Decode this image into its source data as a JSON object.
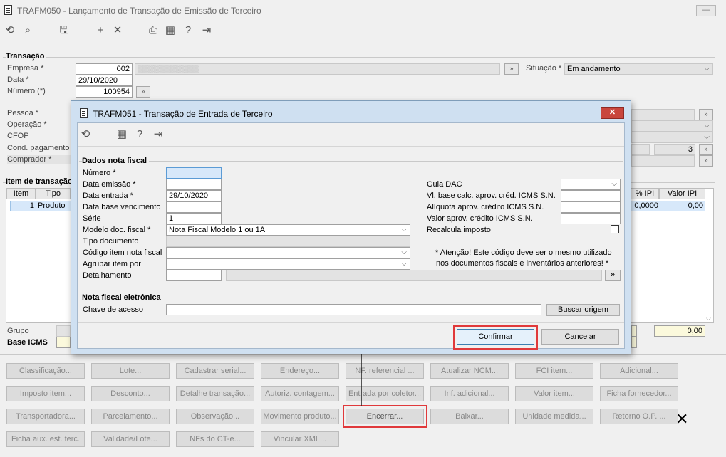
{
  "window": {
    "title": "TRAFM050 - Lançamento de Transação de Emissão de Terceiro"
  },
  "icons": [
    "refresh-icon",
    "search-icon",
    "save-icon",
    "add-icon",
    "delete-icon",
    "print-icon",
    "calendar-icon",
    "help-icon",
    "exit-icon"
  ],
  "transacao": {
    "group_title": "Transação",
    "empresa_label": "Empresa *",
    "empresa_value": "002",
    "empresa_name": "▒▒▒▒▒▒▒▒▒▒▒",
    "data_label": "Data *",
    "data_value": "29/10/2020",
    "numero_label": "Número (*)",
    "numero_value": "100954",
    "situacao_label": "Situação *",
    "situacao_value": "Em andamento",
    "pessoa_label": "Pessoa *",
    "operacao_label": "Operação *",
    "cfop_label": "CFOP",
    "cond_label": "Cond. pagamento *",
    "cond_value": "3",
    "comprador_label": "Comprador *"
  },
  "itens": {
    "group_title": "Item de transação",
    "headers": {
      "item": "Item",
      "tipo": "Tipo",
      "ipi_pct": "% IPI",
      "valor_ipi": "Valor IPI"
    },
    "row": {
      "item": "1",
      "tipo": "Produto",
      "ipi_pct": "0,0000",
      "valor_ipi": "0,00"
    },
    "grupo_label": "Grupo",
    "base_icms_label": "Base ICMS",
    "total_value": "0,00"
  },
  "buttons": [
    [
      "Classificação...",
      "Lote...",
      "Cadastrar serial...",
      "Endereço...",
      "NF. referencial ...",
      "Atualizar NCM...",
      "FCI item...",
      "Adicional..."
    ],
    [
      "Imposto item...",
      "Desconto...",
      "Detalhe transação...",
      "Autoriz. contagem...",
      "Entrada por coletor...",
      "Inf. adicional...",
      "Valor item...",
      "Ficha fornecedor..."
    ],
    [
      "Transportadora...",
      "Parcelamento...",
      "Observação...",
      "Movimento produto...",
      "Encerrar...",
      "Baixar...",
      "Unidade medida...",
      "Retorno O.P. ..."
    ],
    [
      "Ficha aux. est. terc.",
      "Validade/Lote...",
      "NFs do CT-e...",
      "Vincular XML..."
    ]
  ],
  "dialog": {
    "title": "TRAFM051 - Transação de Entrada de Terceiro",
    "close": "✕",
    "dados_title": "Dados nota fiscal",
    "numero_label": "Número *",
    "data_emissao_label": "Data emissão *",
    "data_entrada_label": "Data entrada *",
    "data_entrada_value": "29/10/2020",
    "data_base_label": "Data base vencimento",
    "serie_label": "Série",
    "serie_value": "1",
    "modelo_label": "Modelo doc. fiscal *",
    "modelo_value": "Nota Fiscal Modelo 1 ou 1A",
    "tipo_doc_label": "Tipo documento",
    "codigo_item_label": "Código item nota fiscal",
    "agrupar_label": "Agrupar item por",
    "detalhamento_label": "Detalhamento",
    "detalhamento_btn": "»",
    "guia_dac_label": "Guia DAC",
    "vl_base_label": "Vl. base calc. aprov. créd. ICMS S.N.",
    "aliquota_label": "Alíquota aprov. crédito ICMS S.N.",
    "valor_aprov_label": "Valor aprov. crédito ICMS S.N.",
    "recalcula_label": "Recalcula imposto",
    "atencao_line1": "* Atenção! Este código deve ser o mesmo utilizado",
    "atencao_line2": "nos documentos fiscais e inventários anteriores! *",
    "nfe_title": "Nota fiscal eletrônica",
    "chave_label": "Chave de acesso",
    "buscar_label": "Buscar origem",
    "confirmar_label": "Confirmar",
    "cancelar_label": "Cancelar"
  },
  "annotation": {
    "close_mark": "✕"
  },
  "colors": {
    "highlight": "#e0393b",
    "dialog_frame": "#cfe0f1",
    "selected_row": "#d7e8fa"
  }
}
